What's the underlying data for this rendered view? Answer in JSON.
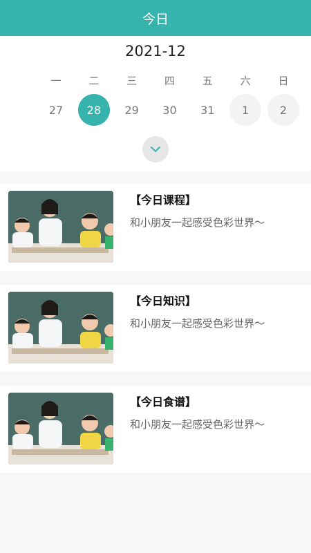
{
  "header": {
    "title": "今日"
  },
  "calendar": {
    "month": "2021-12",
    "weekdays": [
      "一",
      "二",
      "三",
      "四",
      "五",
      "六",
      "日"
    ],
    "days": [
      "27",
      "28",
      "29",
      "30",
      "31",
      "1",
      "2"
    ],
    "selected_day": "28",
    "expand_icon": "chevron-down-icon"
  },
  "cards": [
    {
      "title": "【今日课程】",
      "desc": "和小朋友一起感受色彩世界～"
    },
    {
      "title": "【今日知识】",
      "desc": "和小朋友一起感受色彩世界～"
    },
    {
      "title": "【今日食谱】",
      "desc": "和小朋友一起感受色彩世界～"
    }
  ],
  "colors": {
    "accent": "#35b3ac"
  }
}
